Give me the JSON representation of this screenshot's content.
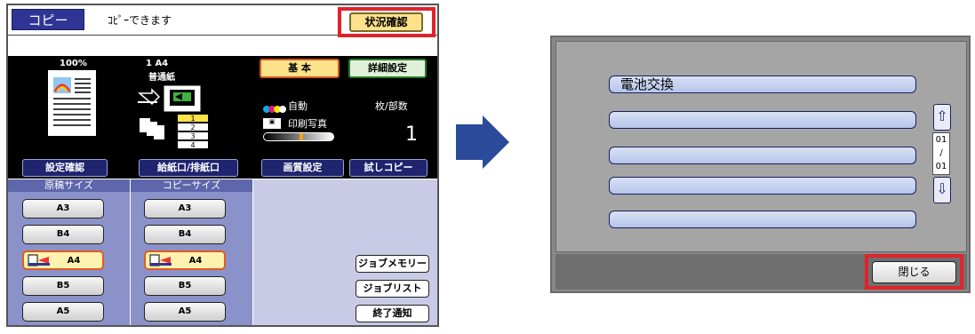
{
  "left_screen": {
    "mode_tab": "コピー",
    "status_message": "ｺﾋﾟｰできます",
    "status_check_button": "状況確認",
    "zoom": "100%",
    "copies_paper_info": "1 A4",
    "paper_type": "普通紙",
    "tray_numbers": [
      "1",
      "2",
      "3",
      "4"
    ],
    "tabs": {
      "basic": "基 本",
      "detail": "詳細設定"
    },
    "color_mode": "自動",
    "sheets_copies_label": "枚/部数",
    "image_mode": "印刷写真",
    "copy_count": "1",
    "setting_confirm_button": "設定確認",
    "tray_button": "給紙口/排紙口",
    "image_quality_button": "画質設定",
    "test_copy_button": "試しコピー",
    "original_size_header": "原稿サイズ",
    "copy_size_header": "コピーサイズ",
    "original_sizes": [
      "A3",
      "B4",
      "A4",
      "B5",
      "A5"
    ],
    "copy_sizes": [
      "A3",
      "B4",
      "A4",
      "B5",
      "A5"
    ],
    "selected_size": "A4",
    "job_memory_button": "ジョブメモリー",
    "job_list_button": "ジョブリスト",
    "end_notice_button": "終了通知"
  },
  "right_screen": {
    "list_items": [
      "電池交換",
      "",
      "",
      "",
      ""
    ],
    "page_current": "01",
    "page_sep": "/",
    "page_total": "01",
    "close_button": "閉じる"
  },
  "colors": {
    "accent_red": "#e1222b",
    "navy": "#2f3594",
    "arrow_blue": "#2a4a9a"
  }
}
